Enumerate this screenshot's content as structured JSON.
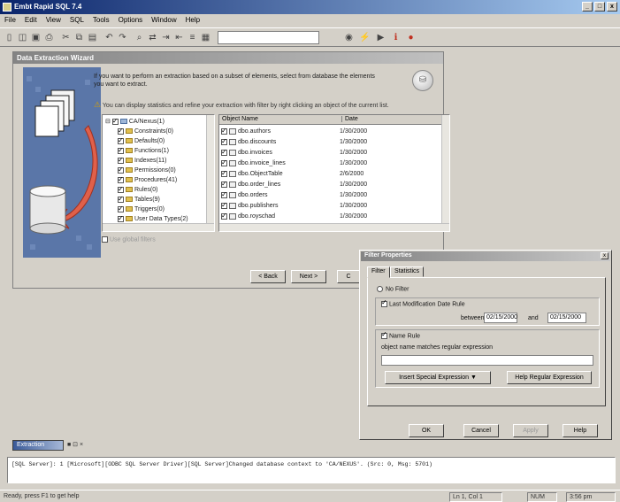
{
  "window": {
    "title": "Embt Rapid SQL 7.4",
    "min": "_",
    "max": "□",
    "close": "x"
  },
  "menu": [
    "File",
    "Edit",
    "View",
    "SQL",
    "Tools",
    "Options",
    "Window",
    "Help"
  ],
  "toolbar": {
    "combo1": "",
    "combo2": ""
  },
  "wizard": {
    "title": "Data Extraction Wizard",
    "instructions": "If you want to perform an extraction based on a subset of elements, select from database the elements you want to extract.",
    "warning": "You can display statistics and refine your extraction with filter by right clicking an object of the current list.",
    "tree": [
      {
        "label": "CA/Nexus(1)",
        "level": 0,
        "checked": true
      },
      {
        "label": "Constraints(0)",
        "level": 1,
        "checked": true
      },
      {
        "label": "Defaults(0)",
        "level": 1,
        "checked": true
      },
      {
        "label": "Functions(1)",
        "level": 1,
        "checked": true
      },
      {
        "label": "Indexes(11)",
        "level": 1,
        "checked": true
      },
      {
        "label": "Permissions(0)",
        "level": 1,
        "checked": true
      },
      {
        "label": "Procedures(41)",
        "level": 1,
        "checked": true
      },
      {
        "label": "Rules(0)",
        "level": 1,
        "checked": true
      },
      {
        "label": "Tables(9)",
        "level": 1,
        "checked": true
      },
      {
        "label": "Triggers(0)",
        "level": 1,
        "checked": true
      },
      {
        "label": "User Data Types(2)",
        "level": 1,
        "checked": true
      }
    ],
    "list_headers": [
      "Object Name",
      "Date"
    ],
    "list_rows": [
      {
        "name": "dbo.authors",
        "date": "1/30/2000"
      },
      {
        "name": "dbo.discounts",
        "date": "1/30/2000"
      },
      {
        "name": "dbo.invoices",
        "date": "1/30/2000"
      },
      {
        "name": "dbo.invoice_lines",
        "date": "1/30/2000"
      },
      {
        "name": "dbo.ObjectTable",
        "date": "2/6/2000"
      },
      {
        "name": "dbo.order_lines",
        "date": "1/30/2000"
      },
      {
        "name": "dbo.orders",
        "date": "1/30/2000"
      },
      {
        "name": "dbo.publishers",
        "date": "1/30/2000"
      },
      {
        "name": "dbo.royschad",
        "date": "1/30/2000"
      }
    ],
    "filter_option": "Use global filters",
    "buttons": {
      "back": "< Back",
      "next": "Next >",
      "cancel": "C"
    }
  },
  "dialog": {
    "title": "Filter Properties",
    "close": "x",
    "tabs": [
      "Filter",
      "Statistics"
    ],
    "no_filter": "No Filter",
    "last_mod": "Last Modification Date Rule",
    "between_label": "between",
    "date_from": "02/15/2000",
    "and_label": "and",
    "date_to": "02/15/2000",
    "name_rule": "Name Rule",
    "regex_label": "object name matches regular expression",
    "regex_value": "",
    "insert_regex": "Insert Special Expression",
    "insert_arrow": "▼",
    "help_regex": "Help Regular Expression",
    "ok": "OK",
    "cancel": "Cancel",
    "apply": "Apply",
    "help": "Help"
  },
  "taskstrip": {
    "item": "Extraction",
    "controls": "■ ⊡ ×"
  },
  "messages": {
    "line1": "[SQL Server]: 1 [Microsoft][ODBC SQL Server Driver][SQL Server]Changed database context to 'CA/NEXUS'. (Src: 0, Msg: 5701)"
  },
  "status": {
    "ready": "Ready, press F1 to get help",
    "pos": "Ln 1, Col 1",
    "mode": "NUM",
    "time": "3:56 pm"
  },
  "colors": {
    "titlebar": "#0a246a",
    "face": "#d4d0c8",
    "art": "#5a76a8",
    "arrow": "#e0604a"
  }
}
